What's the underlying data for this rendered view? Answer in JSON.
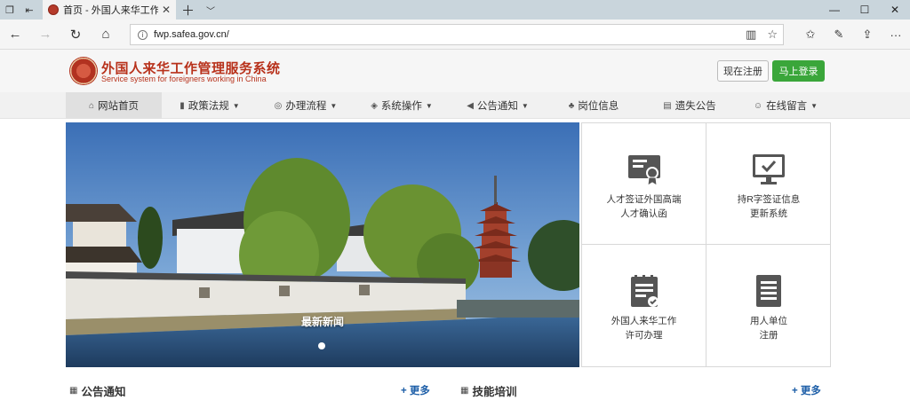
{
  "browser": {
    "tab_title": "首页 - 外国人来华工作管",
    "url": "fwp.safea.gov.cn/"
  },
  "header": {
    "logo_cn": "外国人来华工作管理服务系统",
    "logo_en": "Service system for foreigners working in China",
    "register_label": "现在注册",
    "login_label": "马上登录"
  },
  "nav": {
    "items": [
      {
        "label": "网站首页",
        "icon": "home-icon"
      },
      {
        "label": "政策法规",
        "icon": "book-icon"
      },
      {
        "label": "办理流程",
        "icon": "cog-icon"
      },
      {
        "label": "系统操作",
        "icon": "layers-icon"
      },
      {
        "label": "公告通知",
        "icon": "bullhorn-icon"
      },
      {
        "label": "岗位信息",
        "icon": "sitemap-icon"
      },
      {
        "label": "遗失公告",
        "icon": "file-icon"
      },
      {
        "label": "在线留言",
        "icon": "comments-icon"
      }
    ]
  },
  "hero": {
    "caption": "最新新闻"
  },
  "tiles": [
    {
      "line1": "人才签证外国高端",
      "line2": "人才确认函",
      "icon": "certificate-icon"
    },
    {
      "line1": "持R字签证信息",
      "line2": "更新系统",
      "icon": "monitor-check-icon"
    },
    {
      "line1": "外国人来华工作",
      "line2": "许可办理",
      "icon": "clipboard-check-icon"
    },
    {
      "line1": "用人单位",
      "line2": "注册",
      "icon": "document-list-icon"
    }
  ],
  "sections": {
    "announcements_title": "公告通知",
    "announcements_more": "更多",
    "training_title": "技能培训",
    "training_more": "更多"
  },
  "colors": {
    "brand_red": "#b8321c",
    "login_green": "#3aa63a",
    "more_blue": "#1e5fa8"
  }
}
